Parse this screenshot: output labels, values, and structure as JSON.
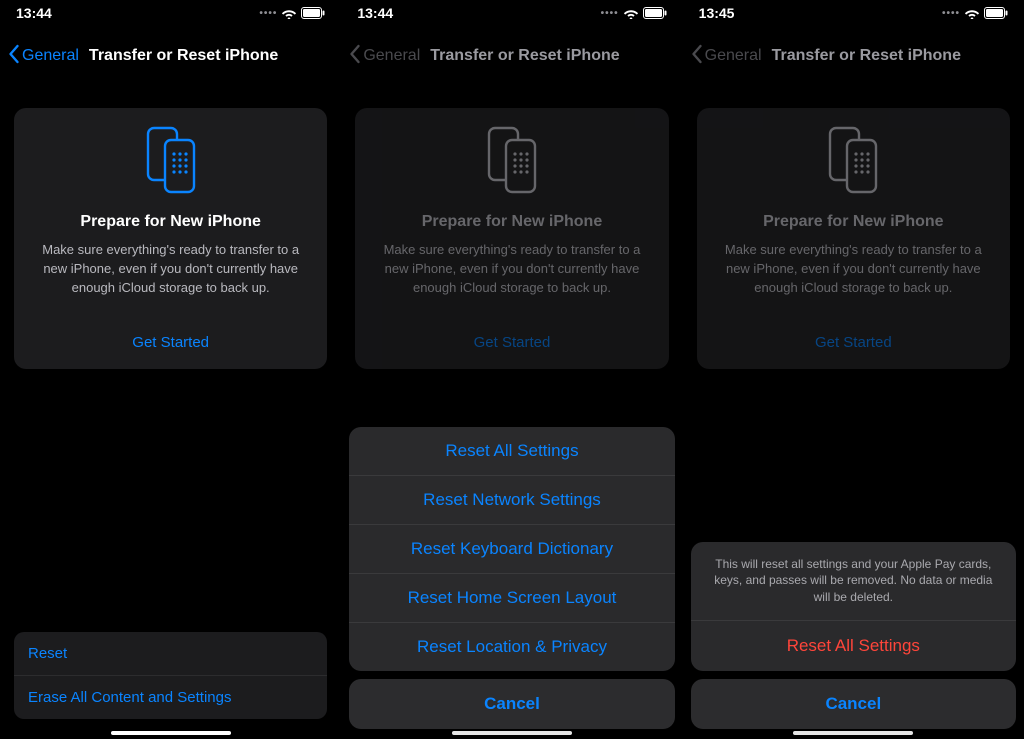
{
  "colors": {
    "accent": "#0a84ff",
    "destructive": "#ff453a"
  },
  "phones": [
    {
      "time": "13:44",
      "back_label": "General",
      "title": "Transfer or Reset iPhone",
      "card": {
        "heading": "Prepare for New iPhone",
        "body": "Make sure everything's ready to transfer to a new iPhone, even if you don't currently have enough iCloud storage to back up.",
        "cta": "Get Started"
      },
      "list": [
        "Reset",
        "Erase All Content and Settings"
      ]
    },
    {
      "time": "13:44",
      "back_label": "General",
      "title": "Transfer or Reset iPhone",
      "card": {
        "heading": "Prepare for New iPhone",
        "body": "Make sure everything's ready to transfer to a new iPhone, even if you don't currently have enough iCloud storage to back up.",
        "cta": "Get Started"
      },
      "sheet": {
        "options": [
          "Reset All Settings",
          "Reset Network Settings",
          "Reset Keyboard Dictionary",
          "Reset Home Screen Layout",
          "Reset Location & Privacy"
        ],
        "cancel": "Cancel"
      }
    },
    {
      "time": "13:45",
      "back_label": "General",
      "title": "Transfer or Reset iPhone",
      "card": {
        "heading": "Prepare for New iPhone",
        "body": "Make sure everything's ready to transfer to a new iPhone, even if you don't currently have enough iCloud storage to back up.",
        "cta": "Get Started"
      },
      "confirm": {
        "message": "This will reset all settings and your Apple Pay cards, keys, and passes will be removed. No data or media will be deleted.",
        "destructive": "Reset All Settings",
        "cancel": "Cancel"
      }
    }
  ]
}
